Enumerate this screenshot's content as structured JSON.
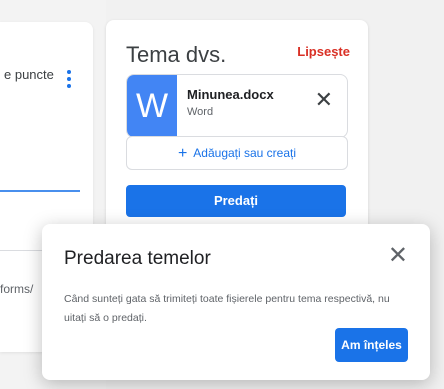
{
  "background": {
    "left_text": "e puncte",
    "left_forms": "forms/"
  },
  "work": {
    "title": "Tema dvs.",
    "status": "Lipsește",
    "file": {
      "thumb_letter": "W",
      "name": "Minunea.docx",
      "type": "Word"
    },
    "add_label": "Adăugați sau creați",
    "turn_in_label": "Predați"
  },
  "dialog": {
    "title": "Predarea temelor",
    "body": "Când sunteți gata să trimiteți toate fișierele pentru tema respectivă, nu uitați să o predați.",
    "ok_label": "Am înțeles"
  },
  "colors": {
    "accent": "#1a73e8",
    "missing": "#d93025",
    "word": "#4285f4"
  }
}
